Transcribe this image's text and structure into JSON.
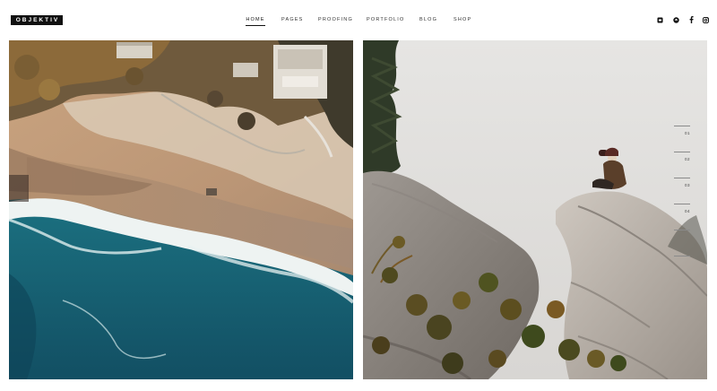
{
  "brand": {
    "logo_text": "OBJEKTIV"
  },
  "nav": {
    "items": [
      {
        "label": "HOME",
        "active": true
      },
      {
        "label": "PAGES"
      },
      {
        "label": "PROOFING"
      },
      {
        "label": "PORTFOLIO"
      },
      {
        "label": "BLOG"
      },
      {
        "label": "SHOP"
      }
    ]
  },
  "social": [
    "square-social-icon",
    "pinterest-icon",
    "facebook-icon",
    "instagram-icon"
  ],
  "gallery": {
    "images": [
      "aerial-beach-photo",
      "cliff-sitting-person-photo"
    ]
  },
  "pager": {
    "items": [
      "01",
      "02",
      "03",
      "04"
    ]
  },
  "colors": {
    "text": "#111111",
    "background": "#ffffff",
    "accent": "#111111"
  }
}
